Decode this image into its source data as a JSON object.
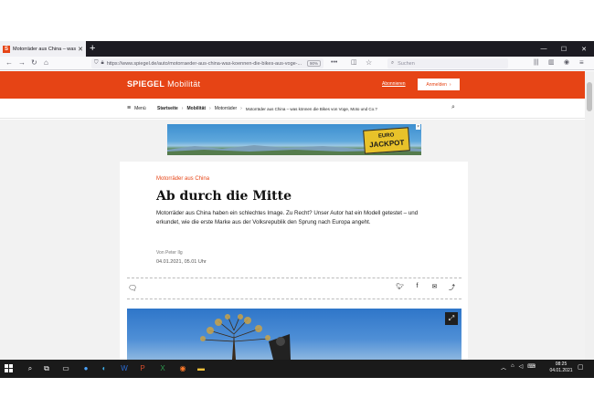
{
  "browser": {
    "tab_title": "Motorräder aus China – was ki...",
    "tab_favicon_letter": "S",
    "url": "https://www.spiegel.de/auto/motorraeder-aus-china-was-koennen-die-bikes-aus-voge-...",
    "zoom": "90%",
    "search_placeholder": "Suchen",
    "colors": {
      "accent": "#e64415",
      "tabbar": "#1c1b22"
    }
  },
  "site": {
    "logo": "SPIEGEL",
    "section": "Mobilität",
    "abo_link": "Abonnieren",
    "login_button": "Anmelden",
    "menu_label": "Menü",
    "breadcrumbs": [
      "Startseite",
      "Mobilität",
      "Motorräder",
      "Motorräder aus China – was können die Bikes von Voge, Moto und Co.?"
    ]
  },
  "ad": {
    "line1": "EURO",
    "line2": "JACKPOT"
  },
  "article": {
    "kicker": "Motorräder aus China",
    "headline": "Ab durch die Mitte",
    "teaser": "Motorräder aus China haben ein schlechtes Image. Zu Recht? Unser Autor hat ein Modell getestet – und erkundet, wie die erste Marke aus der Volksrepublik den Sprung nach Europa angeht.",
    "author": "Von Peter Ilg",
    "date": "04.01.2021, 05.01 Uhr"
  },
  "taskbar": {
    "time": "08:25",
    "date": "04.01.2021"
  }
}
